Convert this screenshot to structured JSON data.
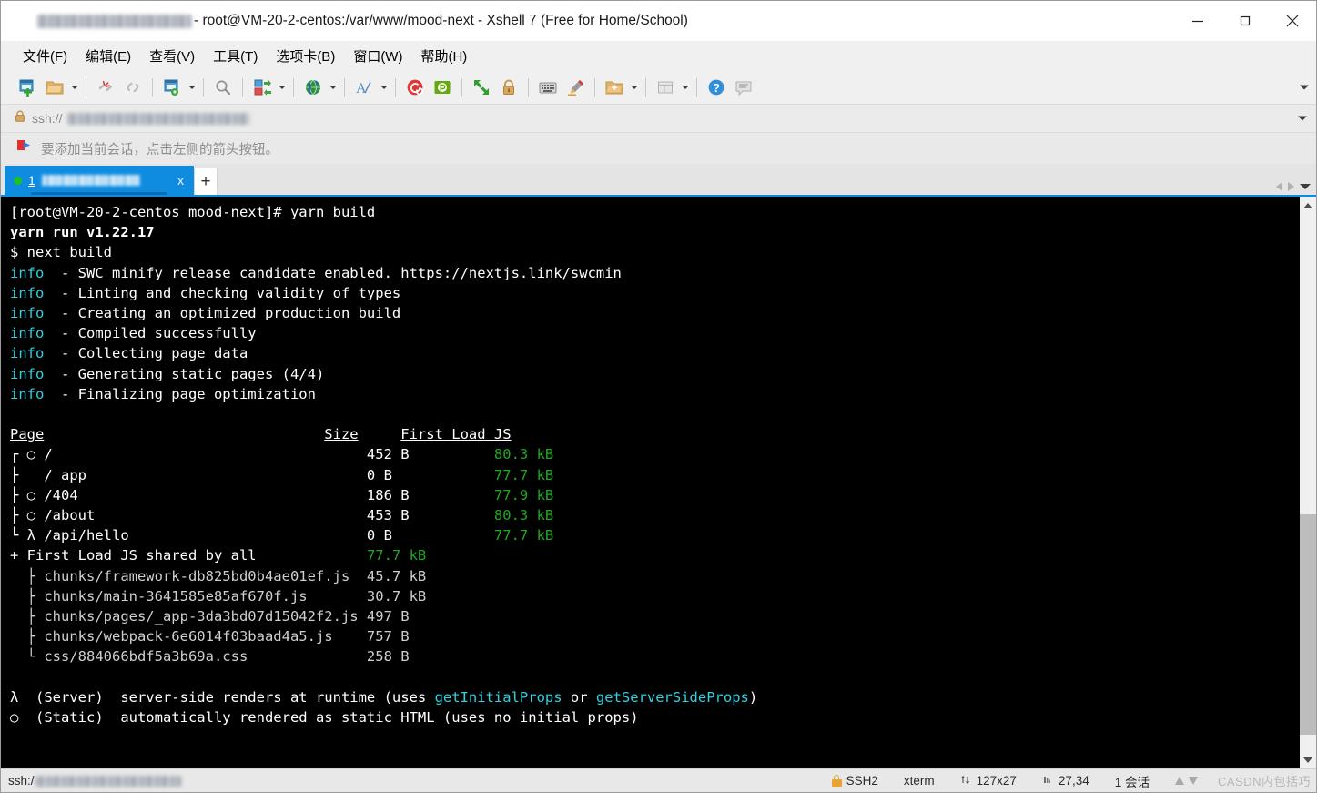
{
  "window": {
    "title": "- root@VM-20-2-centos:/var/www/mood-next - Xshell 7 (Free for Home/School)",
    "minimize_label": "minimize",
    "maximize_label": "maximize",
    "close_label": "close"
  },
  "menu": {
    "items": [
      {
        "label": "文件(F)",
        "name": "menu-file"
      },
      {
        "label": "编辑(E)",
        "name": "menu-edit"
      },
      {
        "label": "查看(V)",
        "name": "menu-view"
      },
      {
        "label": "工具(T)",
        "name": "menu-tools"
      },
      {
        "label": "选项卡(B)",
        "name": "menu-tabs"
      },
      {
        "label": "窗口(W)",
        "name": "menu-window"
      },
      {
        "label": "帮助(H)",
        "name": "menu-help"
      }
    ]
  },
  "address_bar": {
    "prefix": "ssh://",
    "lock_icon": "lock-icon",
    "dropdown_icon": "chevron-down-icon"
  },
  "notice": {
    "text": "要添加当前会话，点击左侧的箭头按钮。",
    "icon": "red-arrow-flag-icon"
  },
  "tabs": {
    "active": {
      "number": "1",
      "close_label": "x"
    },
    "new_tab_label": "+",
    "nav_prev_icon": "chevron-left-icon",
    "nav_next_icon": "chevron-right-icon",
    "nav_list_icon": "chevron-down-icon"
  },
  "terminal": {
    "lines": [
      [
        {
          "t": "[root@VM-20-2-centos mood-next]# yarn build",
          "c": "c-white"
        }
      ],
      [
        {
          "t": "yarn run v1.22.17",
          "c": "c-bold"
        }
      ],
      [
        {
          "t": "$ next build",
          "c": "c-white"
        }
      ],
      [
        {
          "t": "info",
          "c": "c-cyan"
        },
        {
          "t": "  - SWC minify release candidate enabled. https://nextjs.link/swcmin",
          "c": "c-white"
        }
      ],
      [
        {
          "t": "info",
          "c": "c-cyan"
        },
        {
          "t": "  - Linting and checking validity of types",
          "c": "c-white"
        }
      ],
      [
        {
          "t": "info",
          "c": "c-cyan"
        },
        {
          "t": "  - Creating an optimized production build",
          "c": "c-white"
        }
      ],
      [
        {
          "t": "info",
          "c": "c-cyan"
        },
        {
          "t": "  - Compiled successfully",
          "c": "c-white"
        }
      ],
      [
        {
          "t": "info",
          "c": "c-cyan"
        },
        {
          "t": "  - Collecting page data",
          "c": "c-white"
        }
      ],
      [
        {
          "t": "info",
          "c": "c-cyan"
        },
        {
          "t": "  - Generating static pages (4/4)",
          "c": "c-white"
        }
      ],
      [
        {
          "t": "info",
          "c": "c-cyan"
        },
        {
          "t": "  - Finalizing page optimization",
          "c": "c-white"
        }
      ],
      [
        {
          "t": "",
          "c": "c-white"
        }
      ],
      [
        {
          "t": "Page",
          "c": "c-ul"
        },
        {
          "t": "                                 ",
          "c": "c-white"
        },
        {
          "t": "Size",
          "c": "c-ul"
        },
        {
          "t": "     ",
          "c": "c-white"
        },
        {
          "t": "First Load JS",
          "c": "c-ul"
        }
      ],
      [
        {
          "t": "┌ ○ /                                     452 B          ",
          "c": "c-white"
        },
        {
          "t": "80.3 kB",
          "c": "c-green"
        }
      ],
      [
        {
          "t": "├   /_app                                 0 B            ",
          "c": "c-white"
        },
        {
          "t": "77.7 kB",
          "c": "c-green"
        }
      ],
      [
        {
          "t": "├ ○ /404                                  186 B          ",
          "c": "c-white"
        },
        {
          "t": "77.9 kB",
          "c": "c-green"
        }
      ],
      [
        {
          "t": "├ ○ /about                                453 B          ",
          "c": "c-white"
        },
        {
          "t": "80.3 kB",
          "c": "c-green"
        }
      ],
      [
        {
          "t": "└ λ /api/hello                            0 B            ",
          "c": "c-white"
        },
        {
          "t": "77.7 kB",
          "c": "c-green"
        }
      ],
      [
        {
          "t": "+ First Load JS shared by all             ",
          "c": "c-white"
        },
        {
          "t": "77.7 kB",
          "c": "c-green"
        }
      ],
      [
        {
          "t": "  ├ chunks/framework-db825bd0b4ae01ef.js  45.7 kB",
          "c": "c-dim"
        }
      ],
      [
        {
          "t": "  ├ chunks/main-3641585e85af670f.js       30.7 kB",
          "c": "c-dim"
        }
      ],
      [
        {
          "t": "  ├ chunks/pages/_app-3da3bd07d15042f2.js 497 B",
          "c": "c-dim"
        }
      ],
      [
        {
          "t": "  ├ chunks/webpack-6e6014f03baad4a5.js    757 B",
          "c": "c-dim"
        }
      ],
      [
        {
          "t": "  └ css/884066bdf5a3b69a.css              258 B",
          "c": "c-dim"
        }
      ],
      [
        {
          "t": "",
          "c": "c-white"
        }
      ],
      [
        {
          "t": "λ  (Server)  server-side renders at runtime (uses ",
          "c": "c-white"
        },
        {
          "t": "getInitialProps",
          "c": "c-cyan"
        },
        {
          "t": " or ",
          "c": "c-white"
        },
        {
          "t": "getServerSideProps",
          "c": "c-cyan"
        },
        {
          "t": ")",
          "c": "c-white"
        }
      ],
      [
        {
          "t": "○  (Static)  automatically rendered as static HTML (uses no initial props)",
          "c": "c-white"
        }
      ]
    ],
    "build_table": {
      "headers": [
        "Page",
        "Size",
        "First Load JS"
      ],
      "rows": [
        {
          "marker": "○",
          "page": "/",
          "size": "452 B",
          "first_load": "80.3 kB"
        },
        {
          "marker": "",
          "page": "/_app",
          "size": "0 B",
          "first_load": "77.7 kB"
        },
        {
          "marker": "○",
          "page": "/404",
          "size": "186 B",
          "first_load": "77.9 kB"
        },
        {
          "marker": "○",
          "page": "/about",
          "size": "453 B",
          "first_load": "80.3 kB"
        },
        {
          "marker": "λ",
          "page": "/api/hello",
          "size": "0 B",
          "first_load": "77.7 kB"
        }
      ],
      "shared_label": "First Load JS shared by all",
      "shared_value": "77.7 kB",
      "chunks": [
        {
          "name": "chunks/framework-db825bd0b4ae01ef.js",
          "size": "45.7 kB"
        },
        {
          "name": "chunks/main-3641585e85af670f.js",
          "size": "30.7 kB"
        },
        {
          "name": "chunks/pages/_app-3da3bd07d15042f2.js",
          "size": "497 B"
        },
        {
          "name": "chunks/webpack-6e6014f03baad4a5.js",
          "size": "757 B"
        },
        {
          "name": "css/884066bdf5a3b69a.css",
          "size": "258 B"
        }
      ]
    },
    "colors": {
      "background": "#000000",
      "text": "#d9d9d9",
      "info": "#2fd2e0",
      "size_green": "#1ea81e"
    }
  },
  "statusbar": {
    "left_prefix": "ssh:/",
    "protocol": "SSH2",
    "terminal_type": "xterm",
    "dimensions": "127x27",
    "cursor": "27,34",
    "sessions": "1 会话",
    "watermark": "CASDN内包括巧"
  },
  "colors": {
    "accent": "#0f8ce0",
    "chrome": "#f0f0f0",
    "terminal_bg": "#000000"
  }
}
